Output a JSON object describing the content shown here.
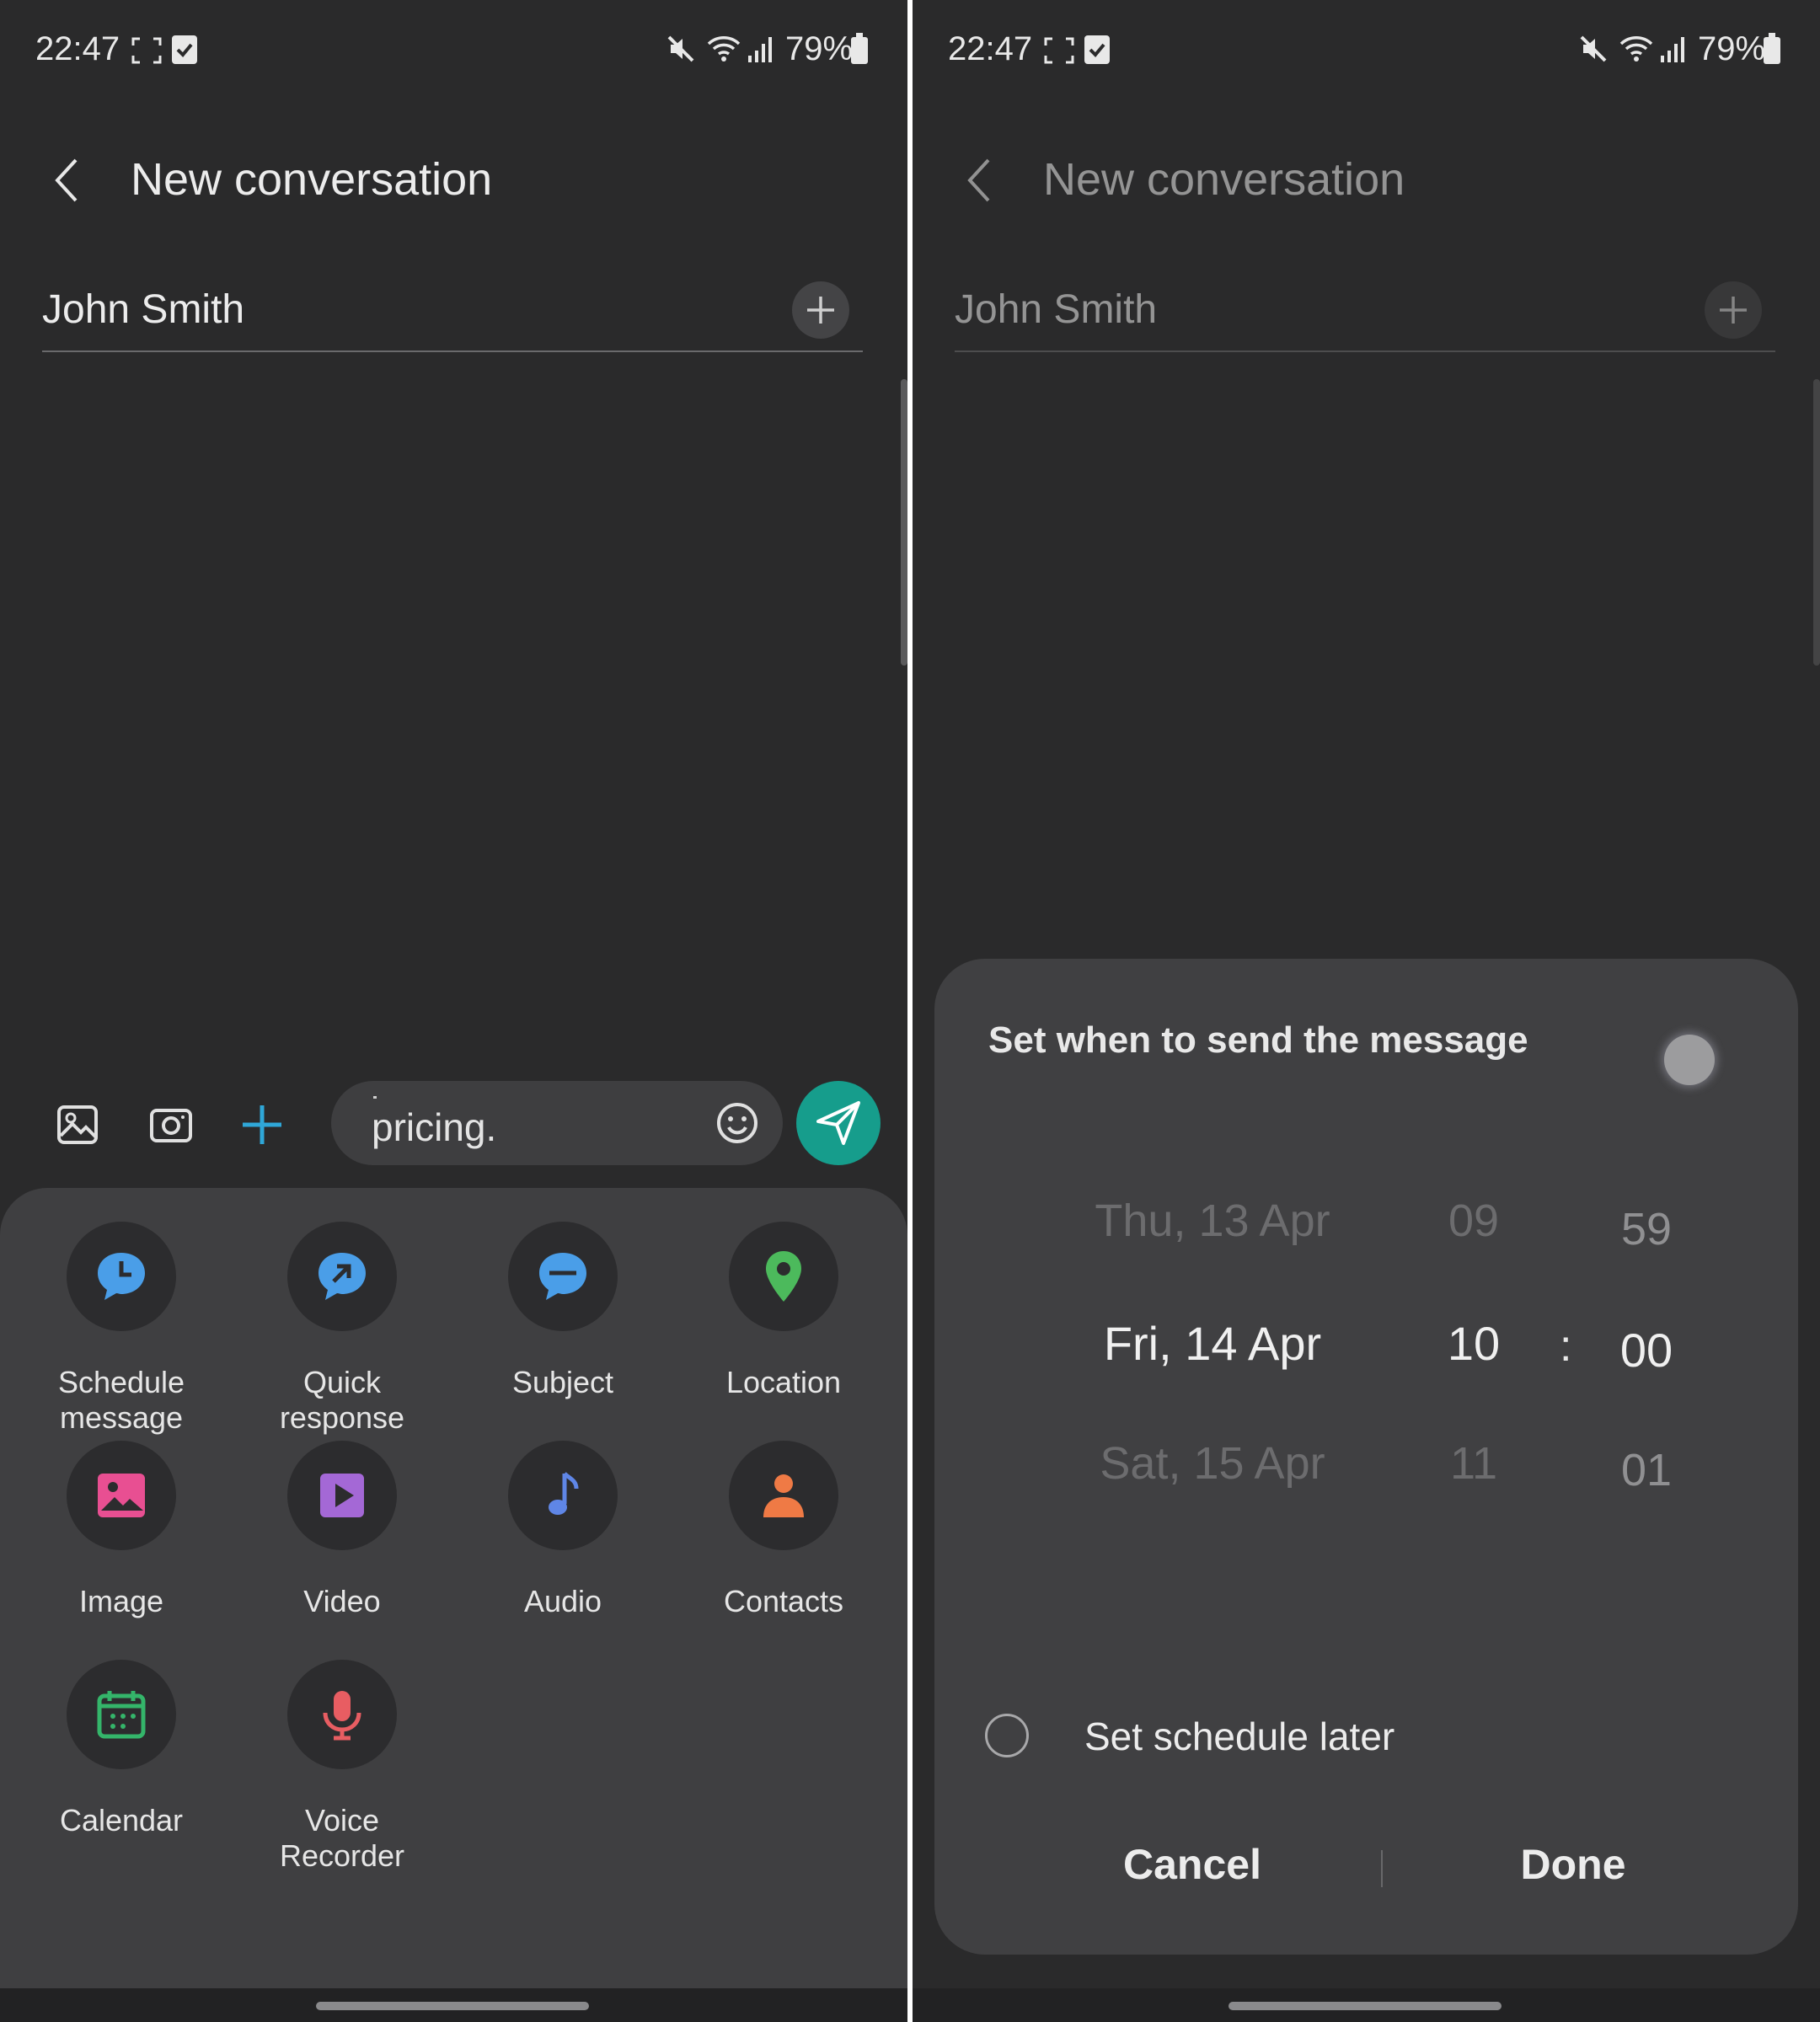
{
  "status_bar": {
    "time": "22:47",
    "battery": "79%"
  },
  "header": {
    "title": "New conversation"
  },
  "recipient": {
    "name": "John Smith"
  },
  "compose": {
    "message_text": "pricing."
  },
  "attachments": [
    {
      "label": "Schedule\nmessage",
      "icon": "schedule-clock-icon",
      "color": "#4a9ee8"
    },
    {
      "label": "Quick\nresponse",
      "icon": "quick-response-icon",
      "color": "#4a9ee8"
    },
    {
      "label": "Subject",
      "icon": "subject-icon",
      "color": "#4a9ee8"
    },
    {
      "label": "Location",
      "icon": "location-pin-icon",
      "color": "#4cba5c"
    },
    {
      "label": "Image",
      "icon": "image-icon",
      "color": "#e84f92"
    },
    {
      "label": "Video",
      "icon": "video-icon",
      "color": "#a468d6"
    },
    {
      "label": "Audio",
      "icon": "music-note-icon",
      "color": "#5f86e6"
    },
    {
      "label": "Contacts",
      "icon": "person-icon",
      "color": "#ef7a45"
    },
    {
      "label": "Calendar",
      "icon": "calendar-icon",
      "color": "#34b56a"
    },
    {
      "label": "Voice\nRecorder",
      "icon": "microphone-icon",
      "color": "#e85d62"
    }
  ],
  "schedule_dialog": {
    "title": "Set when to send the message",
    "date_options": [
      "Thu, 13 Apr",
      "Fri, 14 Apr",
      "Sat, 15 Apr"
    ],
    "hour_options": [
      "09",
      "10",
      "11"
    ],
    "minute_options": [
      "59",
      "00",
      "01"
    ],
    "selected": {
      "date": "Fri, 14 Apr",
      "hour": "10",
      "minute": "00"
    },
    "time_separator": ":",
    "later_option": "Set schedule later",
    "cancel_label": "Cancel",
    "done_label": "Done"
  },
  "colors": {
    "accent_send": "#169d8c",
    "plus_accent": "#2fa7d8",
    "background": "#2a2a2b",
    "sheet": "#3f3f41"
  }
}
